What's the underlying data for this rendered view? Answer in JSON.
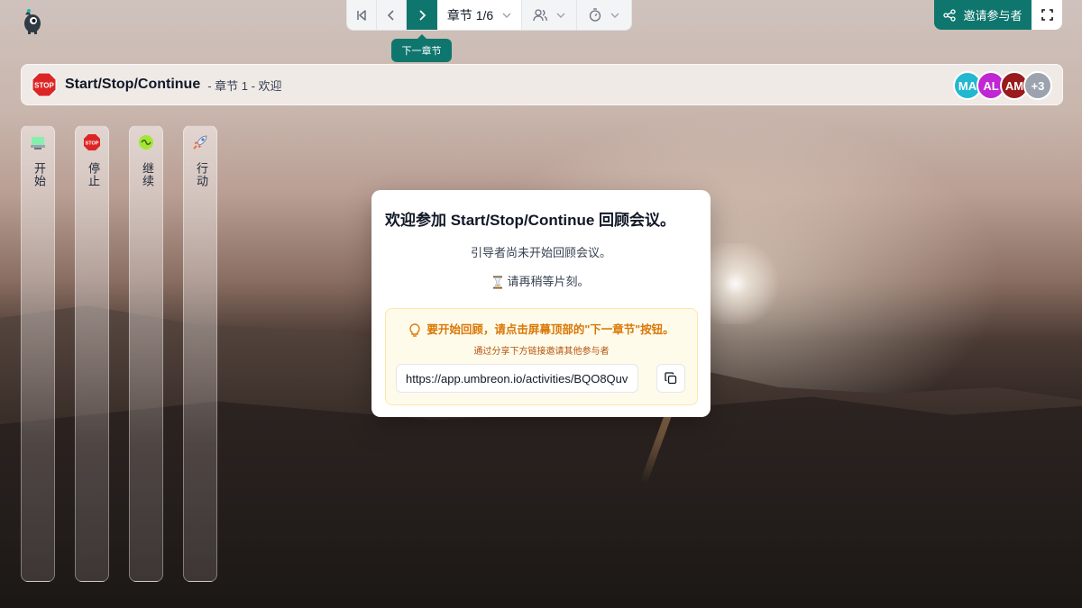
{
  "toolbar": {
    "chapter_label": "章节 1/6",
    "tooltip": "下一章节"
  },
  "invite": {
    "label": "邀请参与者"
  },
  "header": {
    "title": "Start/Stop/Continue",
    "subtitle": "- 章节 1 - 欢迎",
    "avatars": [
      {
        "initials": "MA",
        "color": "#22b8cf"
      },
      {
        "initials": "AL",
        "color": "#c026d3"
      },
      {
        "initials": "AM",
        "color": "#991b1b"
      },
      {
        "initials": "+3",
        "color": "#9ca3af"
      }
    ]
  },
  "columns": [
    {
      "label": "开始",
      "icon": "start-icon"
    },
    {
      "label": "停止",
      "icon": "stop-sign-icon"
    },
    {
      "label": "继续",
      "icon": "continue-icon"
    },
    {
      "label": "行动",
      "icon": "rocket-icon"
    }
  ],
  "modal": {
    "title": "欢迎参加 Start/Stop/Continue 回顾会议。",
    "line1": "引导者尚未开始回顾会议。",
    "line2": "请再稍等片刻。",
    "tip_main": "要开始回顾，请点击屏幕顶部的\"下一章节\"按钮。",
    "tip_sub": "通过分享下方链接邀请其他参与者",
    "share_url": "https://app.umbreon.io/activities/BQO8Quv"
  },
  "colors": {
    "accent": "#0f766e",
    "tip_text": "#d97706"
  }
}
